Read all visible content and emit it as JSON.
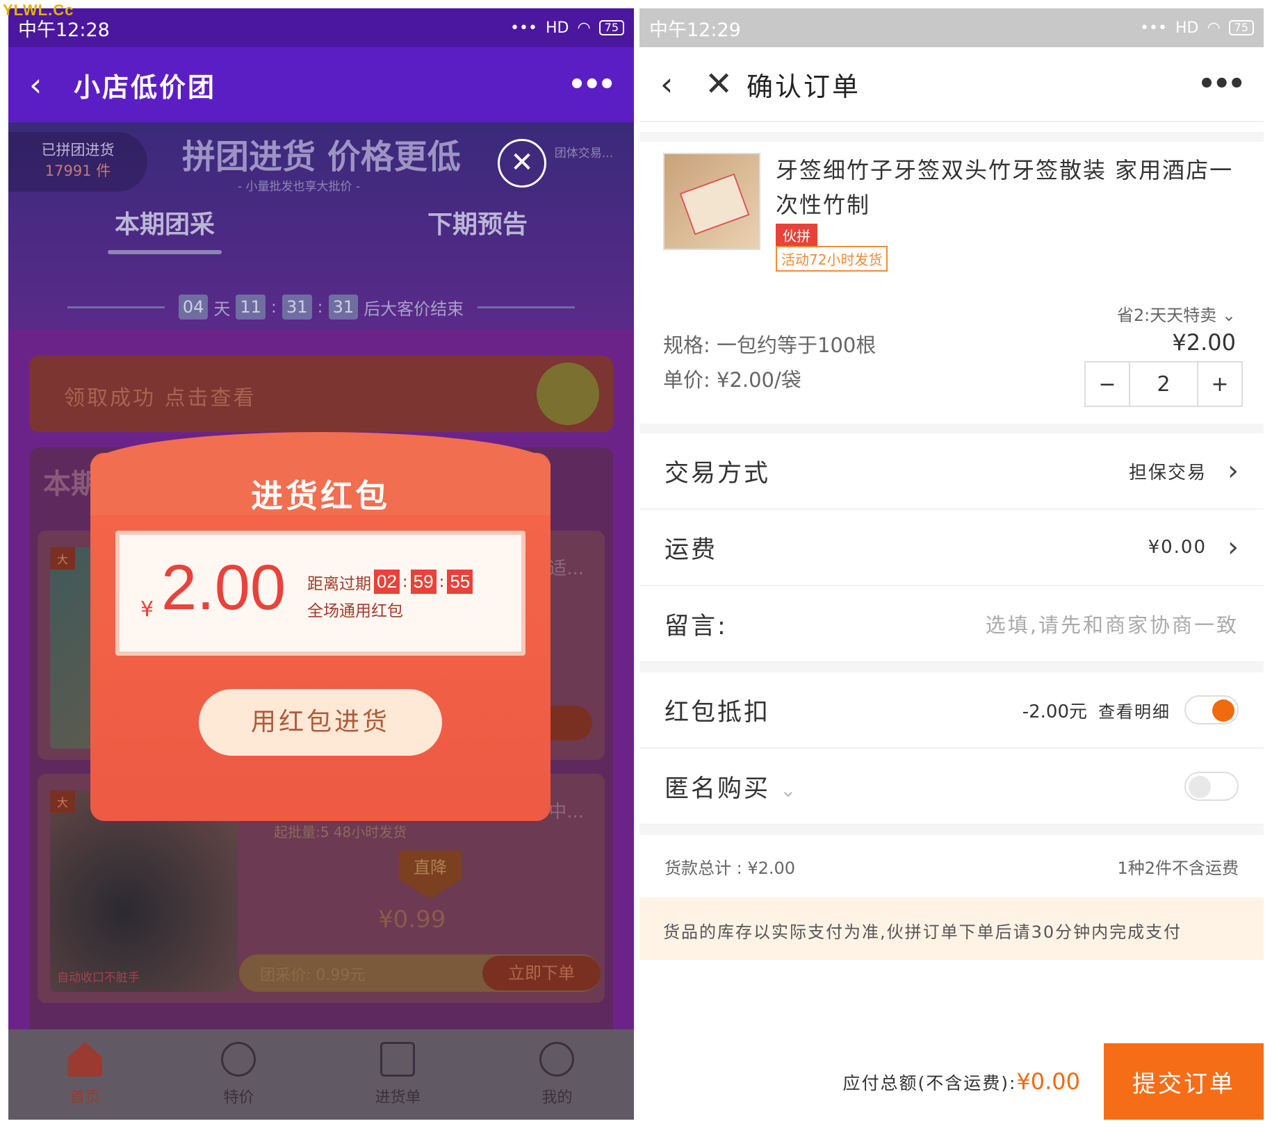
{
  "watermark": "YLWL.Cc",
  "left": {
    "status": {
      "time": "中午12:28",
      "battery": "75",
      "signal_label": "HD"
    },
    "header": {
      "title": "小店低价团"
    },
    "banner": {
      "joined_label": "已拼团进货",
      "joined_count": "17991 件",
      "slogan": "拼团进货 价格更低",
      "sub_slogan": "- 小量批发也享大批价 -",
      "right_text": "团体交易..."
    },
    "tabs": [
      {
        "label": "本期团采"
      },
      {
        "label": "下期预告"
      }
    ],
    "countdown": {
      "d": "04",
      "d_unit": "天",
      "h": "11",
      "m": "31",
      "s": "31",
      "suffix": "后大客价结束"
    },
    "received_banner": "领取成功 点击查看",
    "section_title": "本期",
    "cards": [
      {
        "right_text": "适...",
        "order_btn": "单"
      },
      {
        "right_text": "中...",
        "tag": "自动收口不脏手",
        "min_qty": "起批量:5  48小时发货",
        "drop_label": "直降",
        "price": "¥0.99",
        "group_price": "团采价: 0.99元",
        "order_btn": "立即下单"
      }
    ],
    "nav": [
      {
        "label": "首页"
      },
      {
        "label": "特价"
      },
      {
        "label": "进货单"
      },
      {
        "label": "我的"
      }
    ],
    "modal": {
      "title": "进货红包",
      "currency": "¥",
      "amount": "2.00",
      "expire_label": "距离过期",
      "expire_h": "02",
      "expire_m": "59",
      "expire_s": "55",
      "usage": "全场通用红包",
      "button": "用红包进货"
    }
  },
  "right": {
    "status": {
      "time": "中午12:29",
      "battery": "75",
      "signal_label": "HD"
    },
    "header": {
      "title": "确认订单"
    },
    "product": {
      "title": "牙签细竹子牙签双头竹牙签散装 家用酒店一次性竹制",
      "badge": "伙拼",
      "ship_badge": "活动72小时发货",
      "saving": "省2:天天特卖",
      "spec": "规格: 一包约等于100根",
      "unit_price": "单价: ¥2.00/袋",
      "total": "¥2.00",
      "qty": "2"
    },
    "rows": {
      "trade_label": "交易方式",
      "trade_value": "担保交易",
      "freight_label": "运费",
      "freight_value": "¥0.00",
      "msg_label": "留言:",
      "msg_placeholder": "选填,请先和商家协商一致",
      "redpack_label": "红包抵扣",
      "redpack_value": "-2.00元",
      "redpack_detail": "查看明细",
      "anon_label": "匿名购买"
    },
    "summary": {
      "goods_total": "货款总计 : ¥2.00",
      "count_note": "1种2件不含运费"
    },
    "notice": "货品的库存以实际支付为准,伙拼订单下单后请30分钟内完成支付",
    "footer": {
      "total_label": "应付总额(不含运费):",
      "total_value": "¥0.00",
      "submit": "提交订单"
    }
  }
}
